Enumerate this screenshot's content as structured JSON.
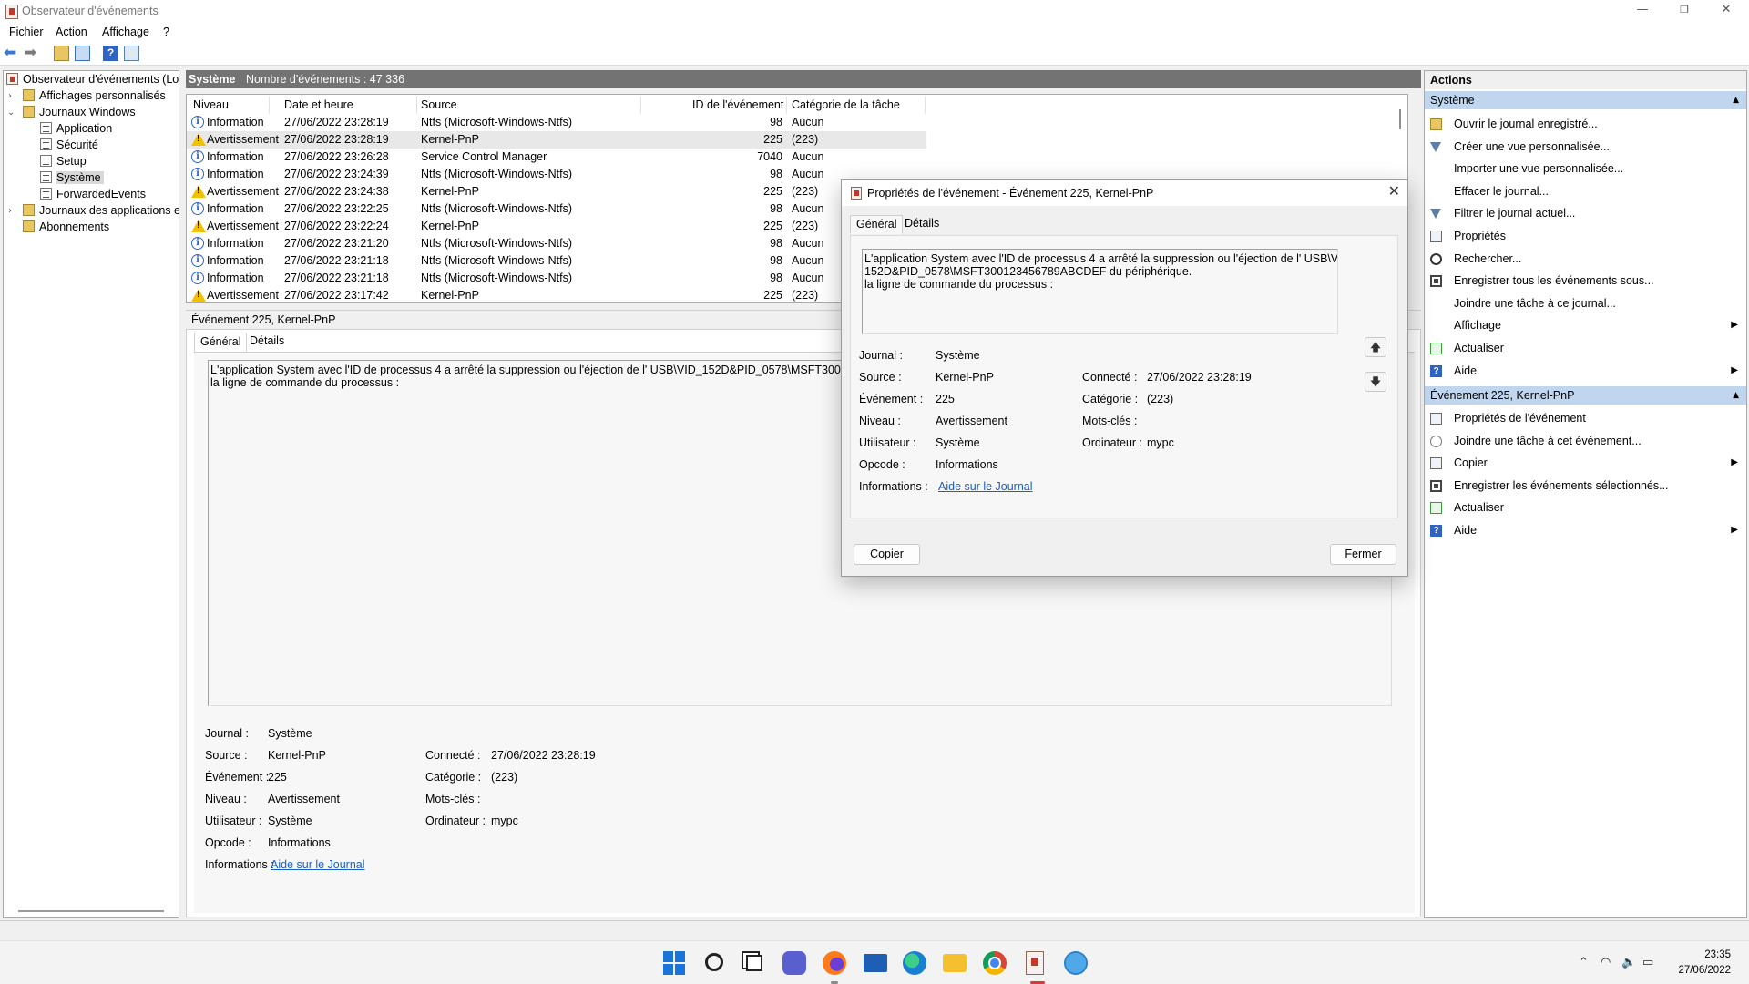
{
  "window": {
    "title": "Observateur d'événements",
    "minimize": "—",
    "maximize": "❐",
    "close": "✕"
  },
  "menu": [
    "Fichier",
    "Action",
    "Affichage",
    "?"
  ],
  "tree": {
    "root": "Observateur d'événements (Loc",
    "custom_views": "Affichages personnalisés",
    "windows_logs": "Journaux Windows",
    "application": "Application",
    "security": "Sécurité",
    "setup": "Setup",
    "system": "Système",
    "forwarded": "ForwardedEvents",
    "app_logs": "Journaux des applications et",
    "subscriptions": "Abonnements"
  },
  "list": {
    "log_name": "Système",
    "event_count": "Nombre d'événements : 47 336",
    "columns": [
      "Niveau",
      "Date et heure",
      "Source",
      "ID de l'événement",
      "Catégorie de la tâche"
    ],
    "rows": [
      {
        "level": "Information",
        "date": "27/06/2022 23:28:19",
        "source": "Ntfs (Microsoft-Windows-Ntfs)",
        "id": "98",
        "category": "Aucun"
      },
      {
        "level": "Avertissement",
        "date": "27/06/2022 23:28:19",
        "source": "Kernel-PnP",
        "id": "225",
        "category": "(223)"
      },
      {
        "level": "Information",
        "date": "27/06/2022 23:26:28",
        "source": "Service Control Manager",
        "id": "7040",
        "category": "Aucun"
      },
      {
        "level": "Information",
        "date": "27/06/2022 23:24:39",
        "source": "Ntfs (Microsoft-Windows-Ntfs)",
        "id": "98",
        "category": "Aucun"
      },
      {
        "level": "Avertissement",
        "date": "27/06/2022 23:24:38",
        "source": "Kernel-PnP",
        "id": "225",
        "category": "(223)"
      },
      {
        "level": "Information",
        "date": "27/06/2022 23:22:25",
        "source": "Ntfs (Microsoft-Windows-Ntfs)",
        "id": "98",
        "category": "Aucun"
      },
      {
        "level": "Avertissement",
        "date": "27/06/2022 23:22:24",
        "source": "Kernel-PnP",
        "id": "225",
        "category": "(223)"
      },
      {
        "level": "Information",
        "date": "27/06/2022 23:21:20",
        "source": "Ntfs (Microsoft-Windows-Ntfs)",
        "id": "98",
        "category": "Aucun"
      },
      {
        "level": "Information",
        "date": "27/06/2022 23:21:18",
        "source": "Ntfs (Microsoft-Windows-Ntfs)",
        "id": "98",
        "category": "Aucun"
      },
      {
        "level": "Information",
        "date": "27/06/2022 23:21:18",
        "source": "Ntfs (Microsoft-Windows-Ntfs)",
        "id": "98",
        "category": "Aucun"
      },
      {
        "level": "Avertissement",
        "date": "27/06/2022 23:17:42",
        "source": "Kernel-PnP",
        "id": "225",
        "category": "(223)"
      }
    ]
  },
  "detail": {
    "header": "Événement 225, Kernel-PnP",
    "tab_general": "Général",
    "tab_details": "Détails",
    "message_line1": "L'application System avec l'ID de processus 4 a arrêté la suppression ou l'éjection de l' USB\\VID_152D&PID_0578\\MSFT300123456789ABCDEF du périphérique.",
    "message_line2": "la ligne de commande du processus :",
    "labels": {
      "journal": "Journal :",
      "source": "Source :",
      "event": "Événement :",
      "level": "Niveau :",
      "user": "Utilisateur :",
      "opcode": "Opcode :",
      "info": "Informations :",
      "logged": "Connecté :",
      "category": "Catégorie :",
      "keywords": "Mots-clés :",
      "computer": "Ordinateur :"
    },
    "values": {
      "journal": "Système",
      "source": "Kernel-PnP",
      "event": "225",
      "level": "Avertissement",
      "user": "Système",
      "opcode": "Informations",
      "info_link": "Aide sur le Journal",
      "logged": "27/06/2022 23:28:19",
      "category": "(223)",
      "keywords": "",
      "computer": "mypc"
    }
  },
  "actions": {
    "title": "Actions",
    "section1": "Système",
    "items1": [
      {
        "label": "Ouvrir le journal enregistré...",
        "icon": "folder-icon",
        "sub": false
      },
      {
        "label": "Créer une vue personnalisée...",
        "icon": "filter-icon",
        "sub": false
      },
      {
        "label": "Importer une vue personnalisée...",
        "icon": "",
        "sub": false
      },
      {
        "label": "Effacer le journal...",
        "icon": "",
        "sub": false
      },
      {
        "label": "Filtrer le journal actuel...",
        "icon": "filter-icon",
        "sub": false
      },
      {
        "label": "Propriétés",
        "icon": "properties-icon",
        "sub": false
      },
      {
        "label": "Rechercher...",
        "icon": "find-icon",
        "sub": false
      },
      {
        "label": "Enregistrer tous les événements sous...",
        "icon": "save-icon",
        "sub": false
      },
      {
        "label": "Joindre une tâche à ce journal...",
        "icon": "",
        "sub": false
      },
      {
        "label": "Affichage",
        "icon": "",
        "sub": true
      },
      {
        "label": "Actualiser",
        "icon": "refresh-icon",
        "sub": false
      },
      {
        "label": "Aide",
        "icon": "help-icon",
        "sub": true
      }
    ],
    "section2": "Événement 225, Kernel-PnP",
    "items2": [
      {
        "label": "Propriétés de l'événement",
        "icon": "properties-icon",
        "sub": false
      },
      {
        "label": "Joindre une tâche à cet événement...",
        "icon": "task-icon",
        "sub": false
      },
      {
        "label": "Copier",
        "icon": "copy-icon",
        "sub": true
      },
      {
        "label": "Enregistrer les événements sélectionnés...",
        "icon": "save-icon",
        "sub": false
      },
      {
        "label": "Actualiser",
        "icon": "refresh-icon",
        "sub": false
      },
      {
        "label": "Aide",
        "icon": "help-icon",
        "sub": true
      }
    ]
  },
  "dialog": {
    "title": "Propriétés de l'événement - Événement 225, Kernel-PnP",
    "close": "✕",
    "tab_general": "Général",
    "tab_details": "Détails",
    "message_line1": "L'application System avec l'ID de processus 4 a arrêté la suppression ou l'éjection de l' USB\\VID_",
    "message_line2": "152D&PID_0578\\MSFT300123456789ABCDEF du périphérique.",
    "message_line3": "la ligne de commande du processus :",
    "copy_button": "Copier",
    "close_button": "Fermer"
  },
  "taskbar": {
    "time": "23:35",
    "date": "27/06/2022",
    "tray": [
      "^",
      "wifi-icon",
      "volume-icon",
      "battery-icon"
    ]
  }
}
